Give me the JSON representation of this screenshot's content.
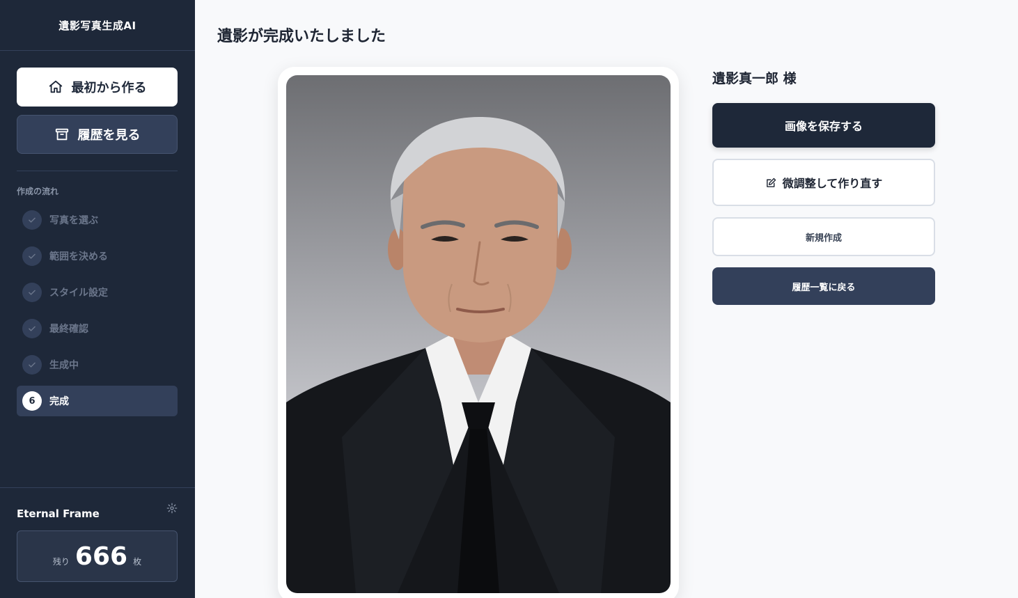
{
  "sidebar": {
    "brand": "遺影写真生成AI",
    "buttons": {
      "start_over": "最初から作る",
      "view_history": "履歴を見る"
    },
    "flow_title": "作成の流れ",
    "steps": [
      {
        "label": "写真を選ぶ",
        "status": "done"
      },
      {
        "label": "範囲を決める",
        "status": "done"
      },
      {
        "label": "スタイル設定",
        "status": "done"
      },
      {
        "label": "最終確認",
        "status": "done"
      },
      {
        "label": "生成中",
        "status": "done"
      },
      {
        "label": "完成",
        "number": "6",
        "status": "active"
      }
    ],
    "footer": {
      "app_name": "Eternal Frame",
      "credits_prefix": "残り",
      "credits_value": "666",
      "credits_suffix": "枚"
    }
  },
  "main": {
    "title": "遺影が完成いたしました",
    "person_name": "遺影真一郎 様",
    "actions": {
      "save": "画像を保存する",
      "adjust": "微調整して作り直す",
      "new": "新規作成",
      "history": "履歴一覧に戻る"
    }
  },
  "icons": {
    "start_over": "home-icon",
    "view_history": "archive-icon",
    "step_done": "check-icon",
    "settings": "gear-icon",
    "adjust": "edit-icon"
  }
}
